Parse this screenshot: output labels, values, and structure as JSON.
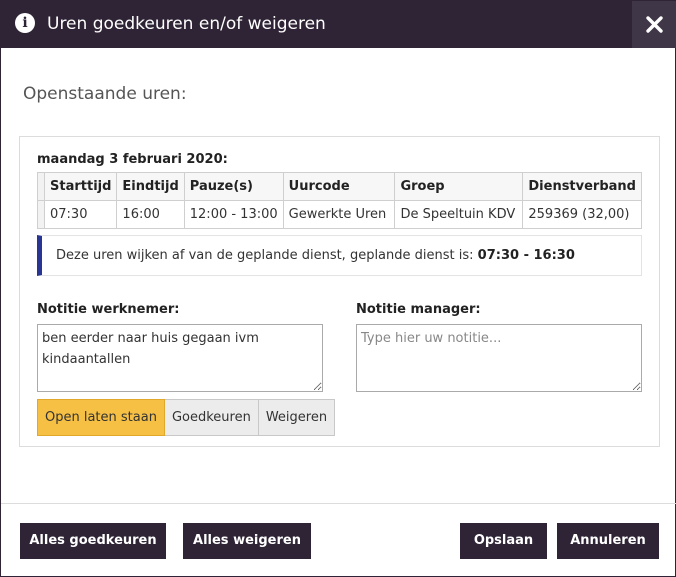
{
  "dialog": {
    "title": "Uren goedkeuren en/of weigeren",
    "info_icon": "info-circle-icon",
    "close_icon": "close-x-icon"
  },
  "section_title": "Openstaande uren:",
  "entry": {
    "date": "maandag 3 februari 2020:",
    "table": {
      "headers": [
        "Starttijd",
        "Eindtijd",
        "Pauze(s)",
        "Uurcode",
        "Groep",
        "Dienstverband"
      ],
      "rows": [
        [
          "07:30",
          "16:00",
          "12:00 - 13:00",
          "Gewerkte Uren",
          "De Speeltuin KDV",
          "259369 (32,00)"
        ]
      ]
    },
    "alert": {
      "text": "Deze uren wijken af van de geplande dienst, geplande dienst is: ",
      "planned": "07:30 - 16:30"
    },
    "employee_note": {
      "label": "Notitie werknemer:",
      "value": "ben eerder naar huis gegaan ivm kindaantallen"
    },
    "manager_note": {
      "label": "Notitie manager:",
      "placeholder": "Type hier uw notitie..."
    },
    "status_options": {
      "open": "Open laten staan",
      "approve": "Goedkeuren",
      "reject": "Weigeren",
      "selected": "open"
    }
  },
  "footer": {
    "approve_all": "Alles goedkeuren",
    "reject_all": "Alles weigeren",
    "save": "Opslaan",
    "cancel": "Annuleren"
  },
  "colors": {
    "header_bg": "#2e2435",
    "close_bg": "#3f3647",
    "active_option": "#f6c044",
    "alert_accent": "#283593"
  }
}
